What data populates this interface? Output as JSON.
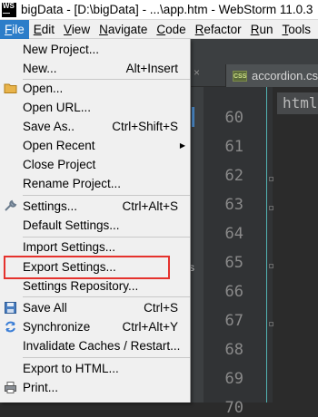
{
  "window": {
    "title": "bigData - [D:\\bigData] - ...\\app.htm - WebStorm 11.0.3",
    "logo_top": "WS",
    "logo_bottom": "—"
  },
  "menubar": {
    "items": [
      {
        "mnemonic": "F",
        "rest": "ile"
      },
      {
        "mnemonic": "E",
        "rest": "dit"
      },
      {
        "mnemonic": "V",
        "rest": "iew"
      },
      {
        "mnemonic": "N",
        "rest": "avigate"
      },
      {
        "mnemonic": "C",
        "rest": "ode"
      },
      {
        "mnemonic": "R",
        "rest": "efactor"
      },
      {
        "mnemonic": "R",
        "rest": "un"
      },
      {
        "mnemonic": "T",
        "rest": "ools"
      }
    ]
  },
  "file_menu": {
    "items": [
      {
        "label": "New Project..."
      },
      {
        "label": "New...",
        "shortcut": "Alt+Insert"
      },
      {
        "label": "Open...",
        "icon": "folder-icon"
      },
      {
        "label": "Open URL..."
      },
      {
        "label": "Save As..",
        "shortcut": "Ctrl+Shift+S"
      },
      {
        "label": "Open Recent",
        "submenu": true
      },
      {
        "label": "Close Project"
      },
      {
        "label": "Rename Project..."
      },
      {
        "label": "Settings...",
        "shortcut": "Ctrl+Alt+S",
        "icon": "wrench-icon"
      },
      {
        "label": "Default Settings..."
      },
      {
        "label": "Import Settings..."
      },
      {
        "label": "Export Settings..."
      },
      {
        "label": "Settings Repository..."
      },
      {
        "label": "Save All",
        "shortcut": "Ctrl+S",
        "icon": "save-icon"
      },
      {
        "label": "Synchronize",
        "shortcut": "Ctrl+Alt+Y",
        "icon": "sync-icon"
      },
      {
        "label": "Invalidate Caches / Restart..."
      },
      {
        "label": "Export to HTML..."
      },
      {
        "label": "Print...",
        "icon": "print-icon"
      }
    ]
  },
  "editor": {
    "tab_close": "×",
    "tab_icon": "CSS",
    "tab_label": "accordion.css",
    "breadcrumb": "html",
    "side_text": "s",
    "line_numbers": [
      "60",
      "61",
      "62",
      "63",
      "64",
      "65",
      "66",
      "67",
      "68",
      "69",
      "70"
    ]
  },
  "colors": {
    "menu_bg": "#f0f0f0",
    "active_menu": "#2c7dc9",
    "editor_bg": "#2b2b2b",
    "gutter_bg": "#313335",
    "highlight_box": "#e5322d"
  }
}
